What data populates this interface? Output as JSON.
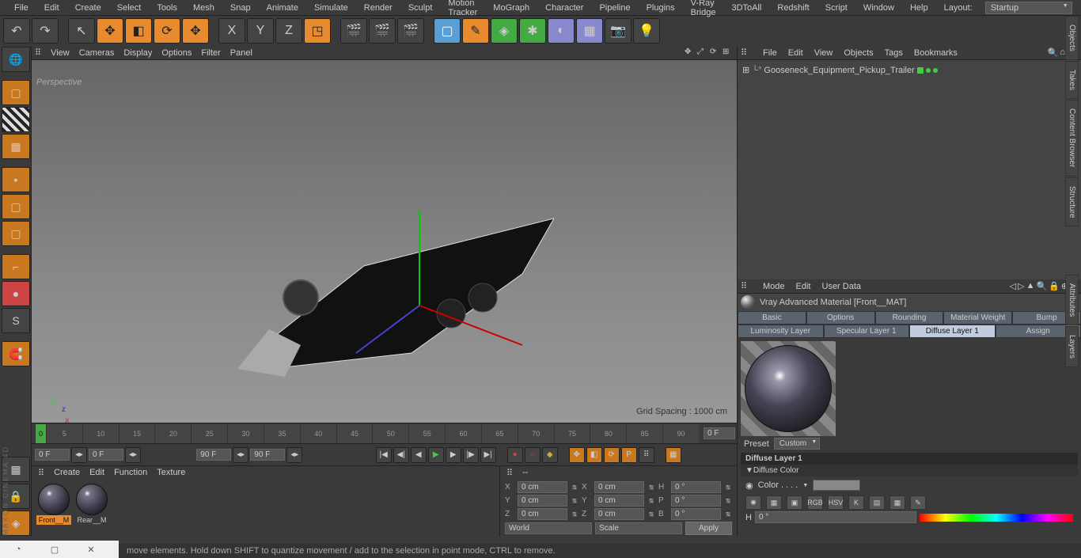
{
  "menubar": [
    "File",
    "Edit",
    "Create",
    "Select",
    "Tools",
    "Mesh",
    "Snap",
    "Animate",
    "Simulate",
    "Render",
    "Sculpt",
    "Motion Tracker",
    "MoGraph",
    "Character",
    "Pipeline",
    "Plugins",
    "V-Ray Bridge",
    "3DToAll",
    "Redshift",
    "Script",
    "Window",
    "Help"
  ],
  "layout": {
    "label": "Layout:",
    "value": "Startup"
  },
  "viewport": {
    "menu": [
      "View",
      "Cameras",
      "Display",
      "Options",
      "Filter",
      "Panel"
    ],
    "label": "Perspective",
    "grid_spacing": "Grid Spacing : 1000 cm"
  },
  "objects": {
    "menu": [
      "File",
      "Edit",
      "View",
      "Objects",
      "Tags",
      "Bookmarks"
    ],
    "item": "Gooseneck_Equipment_Pickup_Trailer"
  },
  "timeline": {
    "ticks": [
      "0",
      "5",
      "10",
      "15",
      "20",
      "25",
      "30",
      "35",
      "40",
      "45",
      "50",
      "55",
      "60",
      "65",
      "70",
      "75",
      "80",
      "85",
      "90"
    ],
    "start": "0 F",
    "end": "0 F",
    "range_start": "0 F",
    "range_end": "0 F",
    "frame_a": "90 F",
    "frame_b": "90 F"
  },
  "materials": {
    "menu": [
      "Create",
      "Edit",
      "Function",
      "Texture"
    ],
    "items": [
      {
        "name": "Front__M",
        "selected": true
      },
      {
        "name": "Rear__M",
        "selected": false
      }
    ]
  },
  "coords": {
    "header": "--",
    "rows": [
      {
        "axis": "X",
        "pos": "0 cm",
        "size_axis": "X",
        "size": "0 cm",
        "rot_axis": "H",
        "rot": "0 °"
      },
      {
        "axis": "Y",
        "pos": "0 cm",
        "size_axis": "Y",
        "size": "0 cm",
        "rot_axis": "P",
        "rot": "0 °"
      },
      {
        "axis": "Z",
        "pos": "0 cm",
        "size_axis": "Z",
        "size": "0 cm",
        "rot_axis": "B",
        "rot": "0 °"
      }
    ],
    "mode1": "World",
    "mode2": "Scale",
    "apply": "Apply"
  },
  "attributes": {
    "menu": [
      "Mode",
      "Edit",
      "User Data"
    ],
    "title": "Vray Advanced Material [Front__MAT]",
    "tabs": [
      "Basic",
      "Options",
      "Rounding",
      "Material Weight",
      "Bump",
      "Luminosity Layer",
      "Specular Layer 1",
      "Diffuse Layer 1",
      "Assign"
    ],
    "active_tab": "Diffuse Layer 1",
    "preset_label": "Preset",
    "preset_value": "Custom",
    "section1": "Diffuse Layer 1",
    "section2": "▼Diffuse Color",
    "color_label": "Color . . . .",
    "icon_labels": [
      "RGB",
      "HSV",
      "K"
    ],
    "h_label": "H",
    "h_value": "0 °"
  },
  "right_tabs": [
    "Objects",
    "Content Browser",
    "Structure",
    "Attributes",
    "Takes",
    "Layers"
  ],
  "status": "move elements. Hold down SHIFT to quantize movement / add to the selection in point mode, CTRL to remove.",
  "brand": "MAXON CINEMA 4D"
}
